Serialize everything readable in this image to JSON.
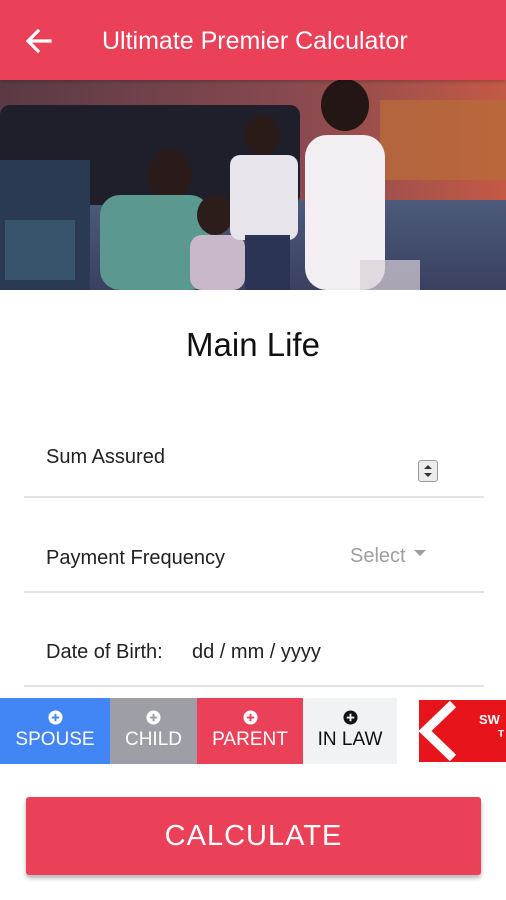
{
  "appbar": {
    "title": "Ultimate Premier Calculator",
    "back_icon": "arrow-left-icon"
  },
  "hero": {
    "image": "family-photo"
  },
  "main": {
    "heading": "Main Life"
  },
  "form": {
    "sum_assured": {
      "label": "Sum Assured",
      "value": ""
    },
    "payment_frequency": {
      "label": "Payment Frequency",
      "selected": "Select"
    },
    "date_of_birth": {
      "label": "Date of Birth:",
      "placeholder": "dd / mm / yyyy"
    }
  },
  "dependants": [
    {
      "label": "SPOUSE",
      "color": "#4285f4",
      "icon": "plus-circle-icon"
    },
    {
      "label": "CHILD",
      "color": "#9e9ea6",
      "icon": "plus-circle-icon"
    },
    {
      "label": "PARENT",
      "color": "#ea4159",
      "icon": "plus-circle-icon"
    },
    {
      "label": "IN LAW",
      "color": "#f0f2f4",
      "icon": "plus-circle-icon"
    }
  ],
  "logo": {
    "text_line1": "SW",
    "text_line2": "T",
    "color": "#e8141c"
  },
  "calculate_label": "CALCULATE",
  "colors": {
    "accent": "#ea4159"
  }
}
